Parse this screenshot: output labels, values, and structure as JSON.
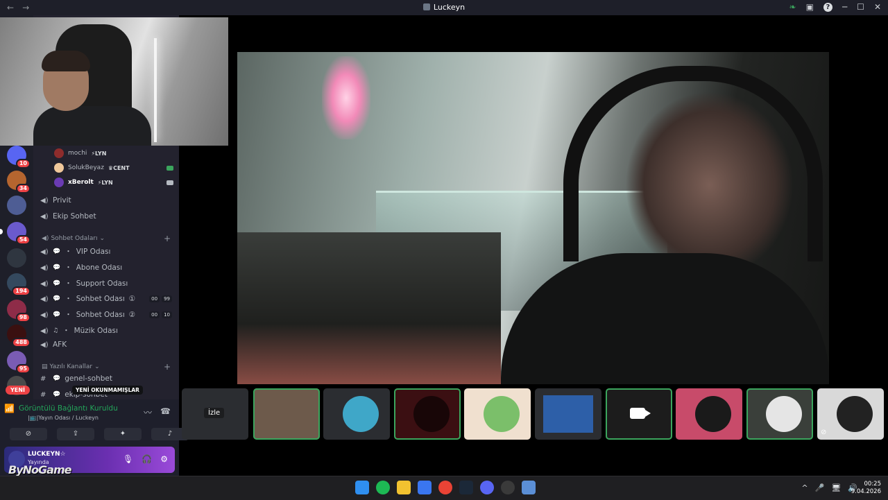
{
  "window": {
    "title": "Luckeyn",
    "back": "←",
    "forward": "→",
    "right_icons": [
      "leaf-icon",
      "inbox-icon",
      "help-icon"
    ],
    "controls": [
      "─",
      "☐",
      "✕"
    ]
  },
  "servers": [
    {
      "badge": "10",
      "color": "#5865f2"
    },
    {
      "badge": "34",
      "color": "#b5652f"
    },
    {
      "badge": "",
      "color": "#4e5d94"
    },
    {
      "badge": "54",
      "color": "#6a5acd"
    },
    {
      "badge": "",
      "color": "#2f3640"
    },
    {
      "badge": "194",
      "color": "#34495e"
    },
    {
      "badge": "98",
      "color": "#8e2c48"
    },
    {
      "badge": "488",
      "color": "#3a1010"
    },
    {
      "badge": "95",
      "color": "#7a5cb4"
    },
    {
      "badge": "",
      "color": "#4a4a4a"
    }
  ],
  "voice_users": [
    {
      "name": "mochi",
      "tag": "⚡LYN",
      "color": "#8e2c2c",
      "cam": "none"
    },
    {
      "name": "SolukBeyaz",
      "tag": "♛CENT",
      "color": "#f0c89b",
      "cam": "green"
    },
    {
      "name": "xBerolt",
      "tag": "⚡LYN",
      "color": "#6a3bb3",
      "cam": "grey"
    }
  ],
  "channels_top": [
    {
      "name": "Privit"
    },
    {
      "name": "Ekip Sohbet"
    }
  ],
  "category_sohbet": "Sohbet Odaları",
  "channels_sohbet": [
    {
      "name": "VIP Odası",
      "prefix": "・"
    },
    {
      "name": "Abone Odası",
      "prefix": "・"
    },
    {
      "name": "Support Odası",
      "prefix": "・"
    },
    {
      "name": "Sohbet Odası",
      "prefix": "・",
      "suffix": "①",
      "count": [
        "00",
        "99"
      ]
    },
    {
      "name": "Sohbet Odası",
      "prefix": "・",
      "suffix": "②",
      "count": [
        "00",
        "10"
      ]
    },
    {
      "name": "Müzik Odası",
      "prefix": "・"
    },
    {
      "name": "AFK",
      "prefix": ""
    }
  ],
  "category_yazili": "Yazılı Kanallar",
  "channels_text": [
    {
      "name": "genel-sohbet"
    },
    {
      "name": "ekip-sohbet"
    }
  ],
  "new_pill": "YENİ",
  "new_unread_tip": "YENİ OKUNMAMIŞLAR",
  "voice_panel": {
    "status": "Görüntülü Bağlantı Kuruldu",
    "subtitle": "|📺|Yayın Odası / Luckeyn",
    "buttons": [
      "camera-off-icon",
      "screen-share-icon",
      "activities-icon",
      "soundboard-icon"
    ]
  },
  "user": {
    "name": "LUCKEYN☆",
    "status": "Yayında",
    "overlay_logo": "ByNoGame"
  },
  "tiles": [
    {
      "type": "label",
      "label": "İzle",
      "active": false,
      "color": "#2b2d31"
    },
    {
      "type": "video",
      "active": true,
      "color": "#6d5a4b"
    },
    {
      "type": "avatar",
      "active": false,
      "color": "#3fa7c8"
    },
    {
      "type": "avatar",
      "active": true,
      "color": "#3b0f12"
    },
    {
      "type": "avatar",
      "active": false,
      "color": "#f0e0cf"
    },
    {
      "type": "video",
      "active": false,
      "color": "#2d5fa8"
    },
    {
      "type": "camera",
      "active": true,
      "color": "#1c1c1c"
    },
    {
      "type": "avatar",
      "active": false,
      "color": "#c84b6a"
    },
    {
      "type": "avatar",
      "active": true,
      "color": "#e5e5e5"
    },
    {
      "type": "avatar",
      "active": false,
      "color": "#e8e8e8",
      "muted": true
    }
  ],
  "taskbar": {
    "apps": [
      "windows-start-icon",
      "spotify-icon",
      "file-explorer-icon",
      "store-icon",
      "chrome-icon",
      "steam-icon",
      "discord-icon",
      "obs-icon",
      "settings-app-icon"
    ],
    "tray": [
      "^",
      "🎤",
      "🖥",
      "🔊"
    ],
    "time": "00:25",
    "date": "9.04.2026"
  }
}
